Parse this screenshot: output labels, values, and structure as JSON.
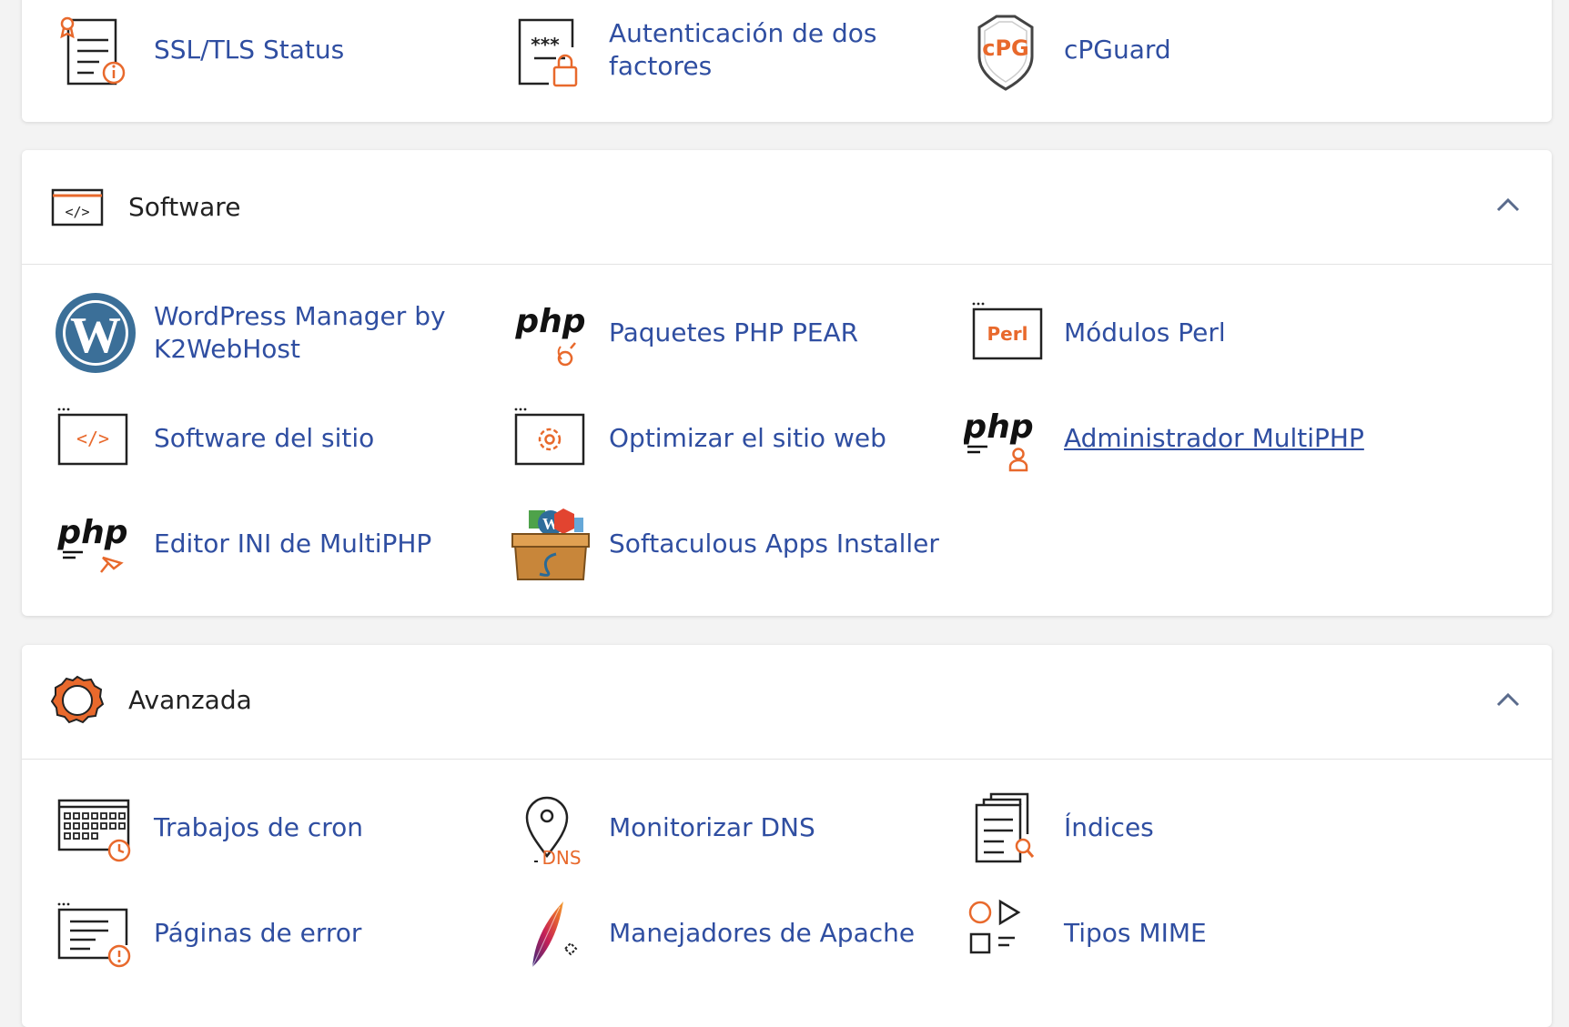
{
  "security": {
    "items": [
      {
        "label": "SSL/TLS Status",
        "icon": "ssl-tls-icon"
      },
      {
        "label": "Autenticación de dos factores",
        "icon": "two-factor-icon"
      },
      {
        "label": "cPGuard",
        "icon": "cpguard-shield-icon"
      }
    ]
  },
  "software": {
    "title": "Software",
    "items": [
      {
        "label": "WordPress Manager by K2WebHost",
        "icon": "wordpress-icon"
      },
      {
        "label": "Paquetes PHP PEAR",
        "icon": "php-pear-icon"
      },
      {
        "label": "Módulos Perl",
        "icon": "perl-icon"
      },
      {
        "label": "Software del sitio",
        "icon": "site-software-icon"
      },
      {
        "label": "Optimizar el sitio web",
        "icon": "optimize-gear-icon"
      },
      {
        "label": "Administrador MultiPHP",
        "icon": "php-manager-icon"
      },
      {
        "label": "Editor INI de MultiPHP",
        "icon": "php-ini-editor-icon"
      },
      {
        "label": "Softaculous Apps Installer",
        "icon": "softaculous-box-icon"
      }
    ]
  },
  "advanced": {
    "title": "Avanzada",
    "items": [
      {
        "label": "Trabajos de cron",
        "icon": "cron-calendar-icon"
      },
      {
        "label": "Monitorizar DNS",
        "icon": "dns-pin-icon"
      },
      {
        "label": "Índices",
        "icon": "indices-icon"
      },
      {
        "label": "Páginas de error",
        "icon": "error-pages-icon"
      },
      {
        "label": "Manejadores de Apache",
        "icon": "apache-feather-icon"
      },
      {
        "label": "Tipos MIME",
        "icon": "mime-types-icon"
      }
    ]
  },
  "icon_labels": {
    "cpg": "cPG",
    "perl": "Perl",
    "php": "php",
    "dns": "DNS"
  },
  "colors": {
    "link": "#2f4ea1",
    "accent": "#e8692c",
    "text": "#222222",
    "background": "#f3f3f3"
  }
}
